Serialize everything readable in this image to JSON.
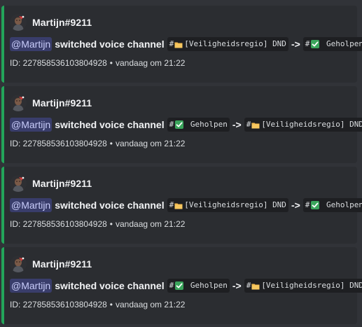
{
  "colors": {
    "background": "#313338",
    "embed_bg": "#2b2d31",
    "embed_border": "#23a55a",
    "mention_bg": "#3c4270",
    "mention_text": "#c9cdfb",
    "code_bg": "#1e1f22",
    "check": "#3ba55c",
    "folder": "#f2b84b"
  },
  "embeds": [
    {
      "author": "Martijn#9211",
      "mention": "@Martijn",
      "action": "switched voice channel",
      "from": {
        "hash": "#",
        "icon": "folder-icon",
        "name": "[Veiligheidsregio] DND"
      },
      "arrow": "->",
      "to": {
        "hash": "#",
        "icon": "check-mark-icon",
        "name": " Geholpen"
      },
      "footer_id": "ID: 227858536103804928",
      "footer_sep": "•",
      "footer_time": "vandaag om 21:22"
    },
    {
      "author": "Martijn#9211",
      "mention": "@Martijn",
      "action": "switched voice channel",
      "from": {
        "hash": "#",
        "icon": "check-mark-icon",
        "name": " Geholpen"
      },
      "arrow": "->",
      "to": {
        "hash": "#",
        "icon": "folder-icon",
        "name": "[Veiligheidsregio] DND"
      },
      "footer_id": "ID: 227858536103804928",
      "footer_sep": "•",
      "footer_time": "vandaag om 21:22"
    },
    {
      "author": "Martijn#9211",
      "mention": "@Martijn",
      "action": "switched voice channel",
      "from": {
        "hash": "#",
        "icon": "folder-icon",
        "name": "[Veiligheidsregio] DND"
      },
      "arrow": "->",
      "to": {
        "hash": "#",
        "icon": "check-mark-icon",
        "name": " Geholpen"
      },
      "footer_id": "ID: 227858536103804928",
      "footer_sep": "•",
      "footer_time": "vandaag om 21:22"
    },
    {
      "author": "Martijn#9211",
      "mention": "@Martijn",
      "action": "switched voice channel",
      "from": {
        "hash": "#",
        "icon": "check-mark-icon",
        "name": " Geholpen"
      },
      "arrow": "->",
      "to": {
        "hash": "#",
        "icon": "folder-icon",
        "name": "[Veiligheidsregio] DND"
      },
      "footer_id": "ID: 227858536103804928",
      "footer_sep": "•",
      "footer_time": "vandaag om 21:22"
    }
  ]
}
